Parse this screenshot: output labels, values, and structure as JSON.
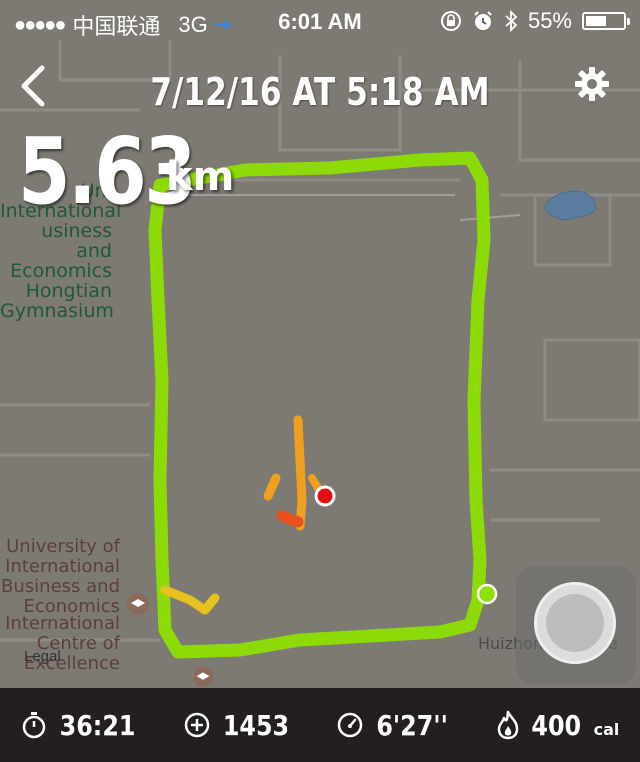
{
  "status_bar": {
    "signal": "●●●●●",
    "carrier": "中国联通",
    "network": "3G",
    "time": "6:01 AM",
    "battery": "55%",
    "battery_level": 0.55
  },
  "header": {
    "title": "7/12/16 AT 5:18 AM"
  },
  "distance": {
    "value": "5.63",
    "unit": "km"
  },
  "map": {
    "labels": {
      "gymnasium": [
        "Uni",
        "International",
        "usiness and",
        "Economics",
        "Hongtian",
        "Gymnasium"
      ],
      "university": [
        "University of",
        "International",
        "Business and",
        "Economics"
      ],
      "centre": [
        "International",
        "Centre of",
        "Excellence"
      ],
      "street": "Huizhong Avenue"
    },
    "legal": "Legal",
    "route_color": "#8ee000",
    "pace_colors": [
      "#e8c21c",
      "#f0a020",
      "#e85020"
    ]
  },
  "stats": {
    "duration": "36:21",
    "calories_value": "400",
    "calories_unit": "cal",
    "steps": "1453",
    "pace": "6'27''"
  }
}
